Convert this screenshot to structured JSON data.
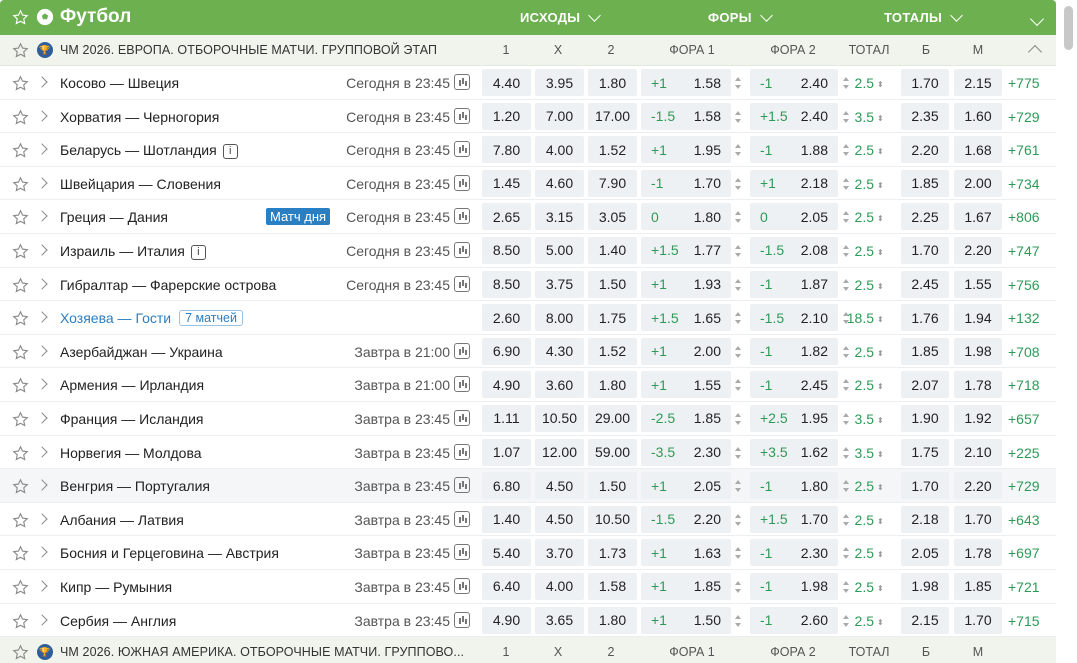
{
  "sport": {
    "title": "Футбол",
    "tabs": [
      "ИСХОДЫ",
      "ФОРЫ",
      "ТОТАЛЫ"
    ]
  },
  "league1": {
    "name": "ЧМ 2026. ЕВРОПА. ОТБОРОЧНЫЕ МАТЧИ. ГРУППОВОЙ ЭТАП",
    "cols": [
      "1",
      "X",
      "2",
      "ФОРА 1",
      "ФОРА 2",
      "ТОТАЛ",
      "Б",
      "М"
    ]
  },
  "league2": {
    "name": "ЧМ 2026. ЮЖНАЯ АМЕРИКА. ОТБОРОЧНЫЕ МАТЧИ. ГРУППОВО...",
    "cols": [
      "1",
      "X",
      "2",
      "ФОРА 1",
      "ФОРА 2",
      "ТОТАЛ",
      "Б",
      "М"
    ]
  },
  "matches": [
    {
      "teams": "Косово — Швеция",
      "time": "Сегодня в 23:45",
      "o1": "4.40",
      "ox": "3.95",
      "o2": "1.80",
      "h1": "+1",
      "f1": "1.58",
      "h2": "-1",
      "f2": "2.40",
      "tot": "2.5",
      "b": "1.70",
      "m": "2.15",
      "more": "+775"
    },
    {
      "teams": "Хорватия — Черногория",
      "time": "Сегодня в 23:45",
      "o1": "1.20",
      "ox": "7.00",
      "o2": "17.00",
      "h1": "-1.5",
      "f1": "1.58",
      "h2": "+1.5",
      "f2": "2.40",
      "tot": "3.5",
      "b": "2.35",
      "m": "1.60",
      "more": "+729"
    },
    {
      "teams": "Беларусь — Шотландия",
      "time": "Сегодня в 23:45",
      "o1": "7.80",
      "ox": "4.00",
      "o2": "1.52",
      "h1": "+1",
      "f1": "1.95",
      "h2": "-1",
      "f2": "1.88",
      "tot": "2.5",
      "b": "2.20",
      "m": "1.68",
      "more": "+761",
      "info": "i"
    },
    {
      "teams": "Швейцария — Словения",
      "time": "Сегодня в 23:45",
      "o1": "1.45",
      "ox": "4.60",
      "o2": "7.90",
      "h1": "-1",
      "f1": "1.70",
      "h2": "+1",
      "f2": "2.18",
      "tot": "2.5",
      "b": "1.85",
      "m": "2.00",
      "more": "+734"
    },
    {
      "teams": "Греция — Дания",
      "time": "Сегодня в 23:45",
      "o1": "2.65",
      "ox": "3.15",
      "o2": "3.05",
      "h1": "0",
      "f1": "1.80",
      "h2": "0",
      "f2": "2.05",
      "tot": "2.5",
      "b": "2.25",
      "m": "1.67",
      "more": "+806",
      "badge": "Матч дня"
    },
    {
      "teams": "Израиль — Италия",
      "time": "Сегодня в 23:45",
      "o1": "8.50",
      "ox": "5.00",
      "o2": "1.40",
      "h1": "+1.5",
      "f1": "1.77",
      "h2": "-1.5",
      "f2": "2.08",
      "tot": "2.5",
      "b": "1.70",
      "m": "2.20",
      "more": "+747",
      "info": "i"
    },
    {
      "teams": "Гибралтар — Фарерские острова",
      "time": "Сегодня в 23:45",
      "o1": "8.50",
      "ox": "3.75",
      "o2": "1.50",
      "h1": "+1",
      "f1": "1.93",
      "h2": "-1",
      "f2": "1.87",
      "tot": "2.5",
      "b": "2.45",
      "m": "1.55",
      "more": "+756"
    },
    {
      "teams": "Хозяева — Гости",
      "time": "",
      "o1": "2.60",
      "ox": "8.00",
      "o2": "1.75",
      "h1": "+1.5",
      "f1": "1.65",
      "h2": "-1.5",
      "f2": "2.10",
      "tot": "18.5",
      "b": "1.76",
      "m": "1.94",
      "more": "+132",
      "count": "7 матчей",
      "link": true
    },
    {
      "teams": "Азербайджан — Украина",
      "time": "Завтра в 21:00",
      "o1": "6.90",
      "ox": "4.30",
      "o2": "1.52",
      "h1": "+1",
      "f1": "2.00",
      "h2": "-1",
      "f2": "1.82",
      "tot": "2.5",
      "b": "1.85",
      "m": "1.98",
      "more": "+708"
    },
    {
      "teams": "Армения — Ирландия",
      "time": "Завтра в 21:00",
      "o1": "4.90",
      "ox": "3.60",
      "o2": "1.80",
      "h1": "+1",
      "f1": "1.55",
      "h2": "-1",
      "f2": "2.45",
      "tot": "2.5",
      "b": "2.07",
      "m": "1.78",
      "more": "+718"
    },
    {
      "teams": "Франция — Исландия",
      "time": "Завтра в 23:45",
      "o1": "1.11",
      "ox": "10.50",
      "o2": "29.00",
      "h1": "-2.5",
      "f1": "1.85",
      "h2": "+2.5",
      "f2": "1.95",
      "tot": "3.5",
      "b": "1.90",
      "m": "1.92",
      "more": "+657"
    },
    {
      "teams": "Норвегия — Молдова",
      "time": "Завтра в 23:45",
      "o1": "1.07",
      "ox": "12.00",
      "o2": "59.00",
      "h1": "-3.5",
      "f1": "2.30",
      "h2": "+3.5",
      "f2": "1.62",
      "tot": "3.5",
      "b": "1.75",
      "m": "2.10",
      "more": "+225"
    },
    {
      "teams": "Венгрия — Португалия",
      "time": "Завтра в 23:45",
      "o1": "6.80",
      "ox": "4.50",
      "o2": "1.50",
      "h1": "+1",
      "f1": "2.05",
      "h2": "-1",
      "f2": "1.80",
      "tot": "2.5",
      "b": "1.70",
      "m": "2.20",
      "more": "+729",
      "hl": true
    },
    {
      "teams": "Албания — Латвия",
      "time": "Завтра в 23:45",
      "o1": "1.40",
      "ox": "4.50",
      "o2": "10.50",
      "h1": "-1.5",
      "f1": "2.20",
      "h2": "+1.5",
      "f2": "1.70",
      "tot": "2.5",
      "b": "2.18",
      "m": "1.70",
      "more": "+643"
    },
    {
      "teams": "Босния и Герцеговина — Австрия",
      "time": "Завтра в 23:45",
      "o1": "5.40",
      "ox": "3.70",
      "o2": "1.73",
      "h1": "+1",
      "f1": "1.63",
      "h2": "-1",
      "f2": "2.30",
      "tot": "2.5",
      "b": "2.05",
      "m": "1.78",
      "more": "+697"
    },
    {
      "teams": "Кипр — Румыния",
      "time": "Завтра в 23:45",
      "o1": "6.40",
      "ox": "4.00",
      "o2": "1.58",
      "h1": "+1",
      "f1": "1.85",
      "h2": "-1",
      "f2": "1.98",
      "tot": "2.5",
      "b": "1.98",
      "m": "1.85",
      "more": "+721"
    },
    {
      "teams": "Сербия — Англия",
      "time": "Завтра в 23:45",
      "o1": "4.90",
      "ox": "3.65",
      "o2": "1.80",
      "h1": "+1",
      "f1": "1.50",
      "h2": "-1",
      "f2": "2.60",
      "tot": "2.5",
      "b": "2.15",
      "m": "1.70",
      "more": "+715"
    }
  ]
}
